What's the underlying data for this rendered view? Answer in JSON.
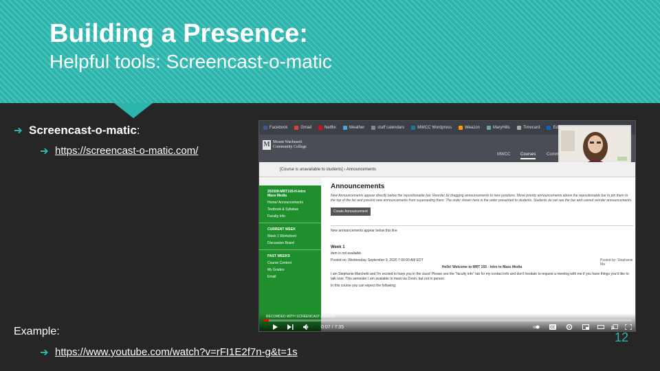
{
  "slide": {
    "title": "Building a Presence:",
    "subtitle": "Helpful tools: Screencast-o-matic",
    "bullet1_bold": "Screencast-o-matic",
    "bullet1_rest": ":",
    "bullet2_link": "https://screencast-o-matic.com/",
    "example_label": "Example:",
    "example_link": "https://www.youtube.com/watch?v=rFI1E2f7n-g&t=1s",
    "page_number": "12",
    "accent_color": "#2bb5ad"
  },
  "video": {
    "bookmarks": [
      "Facebook",
      "Gmail",
      "Netflix",
      "Weather",
      "staff calendars",
      "MWCC Wordpress",
      "Weazon",
      "MaryHills",
      "Timecard",
      "EdTransfer"
    ],
    "logo_mark": "M",
    "college_name": "Mount Wachusett Community College",
    "nav": [
      "MWCC",
      "Courses",
      "Comm"
    ],
    "breadcrumb": "[Course is unavailable to students] › Announcements",
    "sidebar_title": "202009-MRT155-H-Intro Mass Media",
    "sidebar_items_top": [
      "Home/ Announcements",
      "Textbook & Syllabus",
      "Faculty Info"
    ],
    "sidebar_section_current": "CURRENT WEEK",
    "sidebar_items_current": [
      "Week 1 Worksheet",
      "Discussion Board"
    ],
    "sidebar_section_past": "PAST WEEKS",
    "sidebar_items_past": [
      "Course Content",
      "My Grades",
      "Email"
    ],
    "announcements_title": "Announcements",
    "announcements_intro": "New Announcements appear directly below the repositionable bar. Reorder by dragging announcements to new positions. Move priority announcements above the repositionable bar to pin them to the top of the list and prevent new announcements from superseding them. The order shown here is the order presented to students. Students do not see the bar and cannot reorder announcements.",
    "create_button": "Create Announcement",
    "new_below": "New announcements appear below this line",
    "week_title": "Week 1",
    "item_status": "Item is not available.",
    "posted_on": "Posted on: Wednesday, September 9, 2020 7:00:00 AM EDT",
    "hello_line": "Hello! Welcome to MRT 155 - Intro to Mass Media",
    "body_text": "I am Stephanie Marchetti and I'm excited to have you in the class! Please see the \"faculty info\" tab for my contact info and don't hesitate to request a meeting with me if you have things you'd like to talk over. This semester I am available to meet via Zoom, but not in person.",
    "expect_line": "In this course you can expect the following:",
    "posted_by": "Posted by: Stephanie Ma",
    "recorded_with": "RECORDED WITH SCREENCAST-O-MATIC",
    "time_display": "0:07 / 7:35",
    "progress": 0.015
  }
}
